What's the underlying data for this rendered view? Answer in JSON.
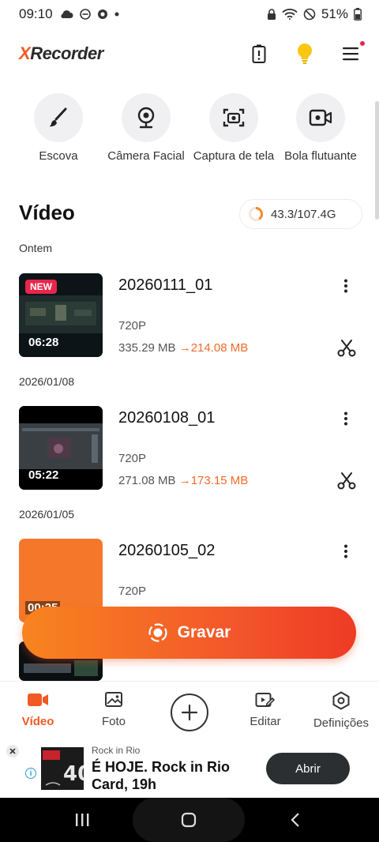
{
  "status_bar": {
    "time": "09:10",
    "battery": "51%"
  },
  "header": {
    "logo_prefix": "X",
    "logo_rest": "Recorder",
    "icons": [
      "battery-alert-icon",
      "lightbulb-icon",
      "menu-icon"
    ]
  },
  "tools": [
    {
      "label": "Escova",
      "icon": "brush-icon"
    },
    {
      "label": "Câmera Facial",
      "icon": "webcam-icon"
    },
    {
      "label": "Captura de tela",
      "icon": "screenshot-icon"
    },
    {
      "label": "Bola flutuante",
      "icon": "floating-camera-icon"
    }
  ],
  "section": {
    "title": "Vídeo",
    "storage": "43.3/107.4G",
    "storage_used_fraction": 0.403
  },
  "groups": [
    {
      "date": "Ontem",
      "videos": [
        {
          "title": "20260111_01",
          "badge": "NEW",
          "duration": "06:28",
          "resolution": "720P",
          "size_original": "335.29 MB",
          "size_compressed": "214.08 MB"
        }
      ]
    },
    {
      "date": "2026/01/08",
      "videos": [
        {
          "title": "20260108_01",
          "duration": "05:22",
          "resolution": "720P",
          "size_original": "271.08 MB",
          "size_compressed": "173.15 MB"
        }
      ]
    },
    {
      "date": "2026/01/05",
      "videos": [
        {
          "title": "20260105_02",
          "duration": "00:25",
          "resolution": "720P"
        }
      ]
    }
  ],
  "record_button": {
    "label": "Gravar"
  },
  "bottom_nav": [
    {
      "label": "Vídeo",
      "icon": "video-camera-icon",
      "active": true
    },
    {
      "label": "Foto",
      "icon": "photo-icon",
      "active": false
    },
    {
      "label": "Editar",
      "icon": "edit-video-icon",
      "active": false
    },
    {
      "label": "Definições",
      "icon": "settings-hexagon-icon",
      "active": false
    }
  ],
  "ad": {
    "sponsor": "Rock in Rio",
    "headline": "É HOJE. Rock in Rio Card, 19h",
    "cta": "Abrir"
  },
  "colors": {
    "accent": "#f15a24",
    "record_gradient_start": "#f8841f",
    "record_gradient_end": "#ee3b25",
    "badge": "#e8264b"
  }
}
